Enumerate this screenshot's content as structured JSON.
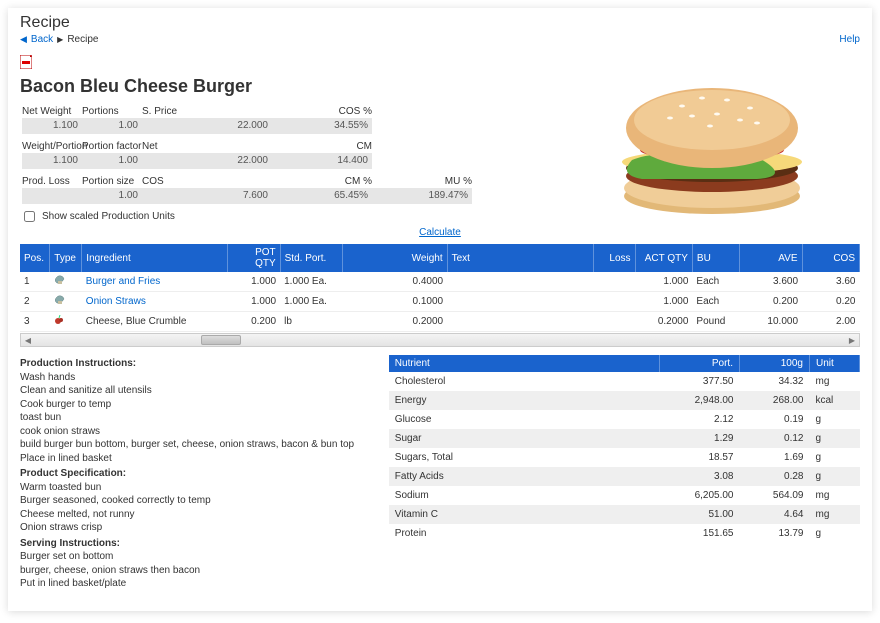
{
  "page": {
    "title": "Recipe",
    "back": "Back",
    "crumb": "Recipe",
    "help": "Help"
  },
  "recipe": {
    "title": "Bacon Bleu Cheese Burger"
  },
  "info": {
    "row1": {
      "labels": [
        "Net Weight",
        "Portions",
        "S. Price",
        "",
        "COS %"
      ],
      "values": [
        "1.100",
        "1.00",
        "",
        "22.000",
        "34.55%"
      ]
    },
    "row2": {
      "labels": [
        "Weight/Portion",
        "Portion factor",
        "Net",
        "",
        "CM"
      ],
      "values": [
        "1.100",
        "1.00",
        "",
        "22.000",
        "14.400"
      ]
    },
    "row3": {
      "labels": [
        "Prod. Loss",
        "Portion size",
        "COS",
        "",
        "CM %",
        "MU %"
      ],
      "values": [
        "",
        "1.00",
        "",
        "7.600",
        "65.45%",
        "189.47%"
      ]
    }
  },
  "showScaled": "Show scaled Production Units",
  "calculate": "Calculate",
  "ingHeaders": [
    "Pos.",
    "Type",
    "Ingredient",
    "POT QTY",
    "Std. Port.",
    "Weight",
    "Text",
    "Loss",
    "ACT QTY",
    "BU",
    "AVE",
    "COS"
  ],
  "ingredients": [
    {
      "pos": "1",
      "icon": "mix",
      "name": "Burger and Fries",
      "link": true,
      "pot": "1.000",
      "std": "1.000 Ea.",
      "weight": "0.4000",
      "act": "1.000",
      "bu": "Each",
      "ave": "3.600",
      "cos": "3.60"
    },
    {
      "pos": "2",
      "icon": "mix",
      "name": "Onion Straws",
      "link": true,
      "pot": "1.000",
      "std": "1.000 Ea.",
      "weight": "0.1000",
      "act": "1.000",
      "bu": "Each",
      "ave": "0.200",
      "cos": "0.20"
    },
    {
      "pos": "3",
      "icon": "berry",
      "name": "Cheese, Blue Crumble",
      "link": false,
      "pot": "0.200",
      "std": "lb",
      "weight": "0.2000",
      "act": "0.2000",
      "bu": "Pound",
      "ave": "10.000",
      "cos": "2.00"
    }
  ],
  "instructions": {
    "prodH": "Production Instructions:",
    "prod": [
      "Wash hands",
      "Clean and sanitize all utensils",
      "Cook burger to temp",
      "toast bun",
      "cook onion straws",
      "build burger bun bottom, burger set, cheese, onion straws, bacon & bun top",
      "Place in lined basket"
    ],
    "specH": "Product Specification:",
    "spec": [
      "Warm toasted bun",
      "Burger seasoned, cooked correctly to temp",
      "Cheese melted, not runny",
      "Onion straws crisp"
    ],
    "servH": "Serving Instructions:",
    "serv": [
      "Burger set on bottom",
      "burger, cheese, onion straws then bacon",
      "Put in lined basket/plate"
    ]
  },
  "nutrHeaders": [
    "Nutrient",
    "Port.",
    "100g",
    "Unit"
  ],
  "nutrients": [
    {
      "n": "Cholesterol",
      "p": "377.50",
      "g": "34.32",
      "u": "mg"
    },
    {
      "n": "Energy",
      "p": "2,948.00",
      "g": "268.00",
      "u": "kcal"
    },
    {
      "n": "Glucose",
      "p": "2.12",
      "g": "0.19",
      "u": "g"
    },
    {
      "n": "Sugar",
      "p": "1.29",
      "g": "0.12",
      "u": "g"
    },
    {
      "n": "Sugars, Total",
      "p": "18.57",
      "g": "1.69",
      "u": "g"
    },
    {
      "n": "Fatty Acids",
      "p": "3.08",
      "g": "0.28",
      "u": "g"
    },
    {
      "n": "Sodium",
      "p": "6,205.00",
      "g": "564.09",
      "u": "mg"
    },
    {
      "n": "Vitamin C",
      "p": "51.00",
      "g": "4.64",
      "u": "mg"
    },
    {
      "n": "Protein",
      "p": "151.65",
      "g": "13.79",
      "u": "g"
    }
  ]
}
